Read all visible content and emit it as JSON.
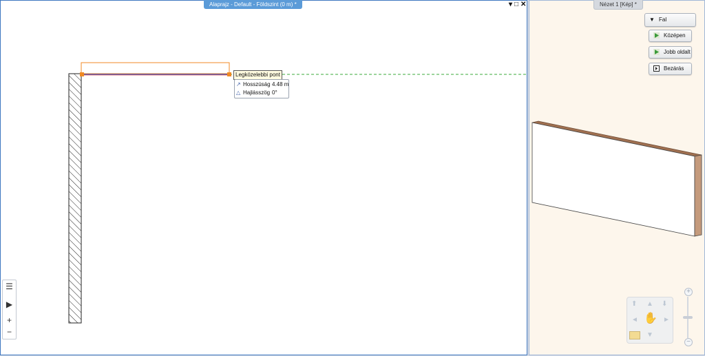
{
  "left_panel": {
    "title": "Alaprajz - Default - Földszint (0 m) *",
    "controls": [
      "▾",
      "□",
      "✕"
    ],
    "snap_label": "Legközelebbi pont",
    "info": [
      {
        "icon": "↗",
        "label": "Hosszúság",
        "value": "4.48 m"
      },
      {
        "icon": "△",
        "label": "Hajlásszög",
        "value": "0°"
      }
    ],
    "toolbar": {
      "list_icon": "☰",
      "expand_icon": "▶",
      "plus": "+",
      "minus": "−"
    }
  },
  "right_panel": {
    "title": "Nézet 1 [Kép] *",
    "menu_header": "Fal",
    "buttons": [
      {
        "label": "Középen"
      },
      {
        "label": "Jobb oldalt"
      },
      {
        "label": "Bezárás"
      }
    ],
    "zoom": {
      "plus": "+",
      "minus": "−"
    }
  },
  "colors": {
    "accent": "#5b9bd8",
    "snap_orange": "#f08a24",
    "guide_green": "#3aa83a",
    "wall_side": "#b98a6c",
    "view_bg": "#fdf6ec"
  }
}
